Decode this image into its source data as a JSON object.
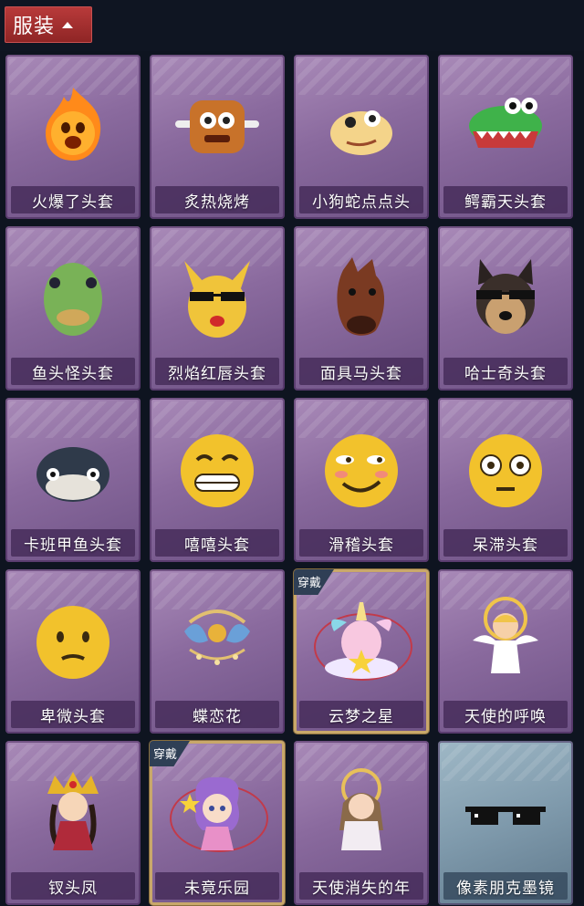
{
  "section": {
    "label": "服装"
  },
  "items": [
    {
      "name": "火爆了头套",
      "icon": "fire-head-icon",
      "equipped": false
    },
    {
      "name": "炙热烧烤",
      "icon": "barbecue-head-icon",
      "equipped": false
    },
    {
      "name": "小狗蛇点点头",
      "icon": "snake-head-icon",
      "equipped": false
    },
    {
      "name": "鳄霸天头套",
      "icon": "crocodile-head-icon",
      "equipped": false
    },
    {
      "name": "鱼头怪头套",
      "icon": "fish-head-icon",
      "equipped": false
    },
    {
      "name": "烈焰红唇头套",
      "icon": "yellow-mouse-head-icon",
      "equipped": false
    },
    {
      "name": "面具马头套",
      "icon": "horse-head-icon",
      "equipped": false
    },
    {
      "name": "哈士奇头套",
      "icon": "husky-head-icon",
      "equipped": false
    },
    {
      "name": "卡班甲鱼头套",
      "icon": "turtle-head-icon",
      "equipped": false
    },
    {
      "name": "嘻嘻头套",
      "icon": "grin-emoji-head-icon",
      "equipped": false
    },
    {
      "name": "滑稽头套",
      "icon": "smirk-emoji-head-icon",
      "equipped": false
    },
    {
      "name": "呆滞头套",
      "icon": "dazed-emoji-head-icon",
      "equipped": false
    },
    {
      "name": "卑微头套",
      "icon": "humble-emoji-head-icon",
      "equipped": false
    },
    {
      "name": "蝶恋花",
      "icon": "butterfly-crown-icon",
      "equipped": false
    },
    {
      "name": "云梦之星",
      "icon": "unicorn-cloud-icon",
      "equipped": true,
      "badge": "穿戴"
    },
    {
      "name": "天使的呼唤",
      "icon": "angel-figure-icon",
      "equipped": false
    },
    {
      "name": "钗头凤",
      "icon": "phoenix-crown-figure-icon",
      "equipped": false
    },
    {
      "name": "未竟乐园",
      "icon": "fairy-figure-icon",
      "equipped": true,
      "badge": "穿戴"
    },
    {
      "name": "天使消失的年",
      "icon": "angel-girl-figure-icon",
      "equipped": false
    },
    {
      "name": "像素朋克墨镜",
      "icon": "pixel-sunglasses-icon",
      "equipped": false,
      "variant": "blue"
    }
  ]
}
